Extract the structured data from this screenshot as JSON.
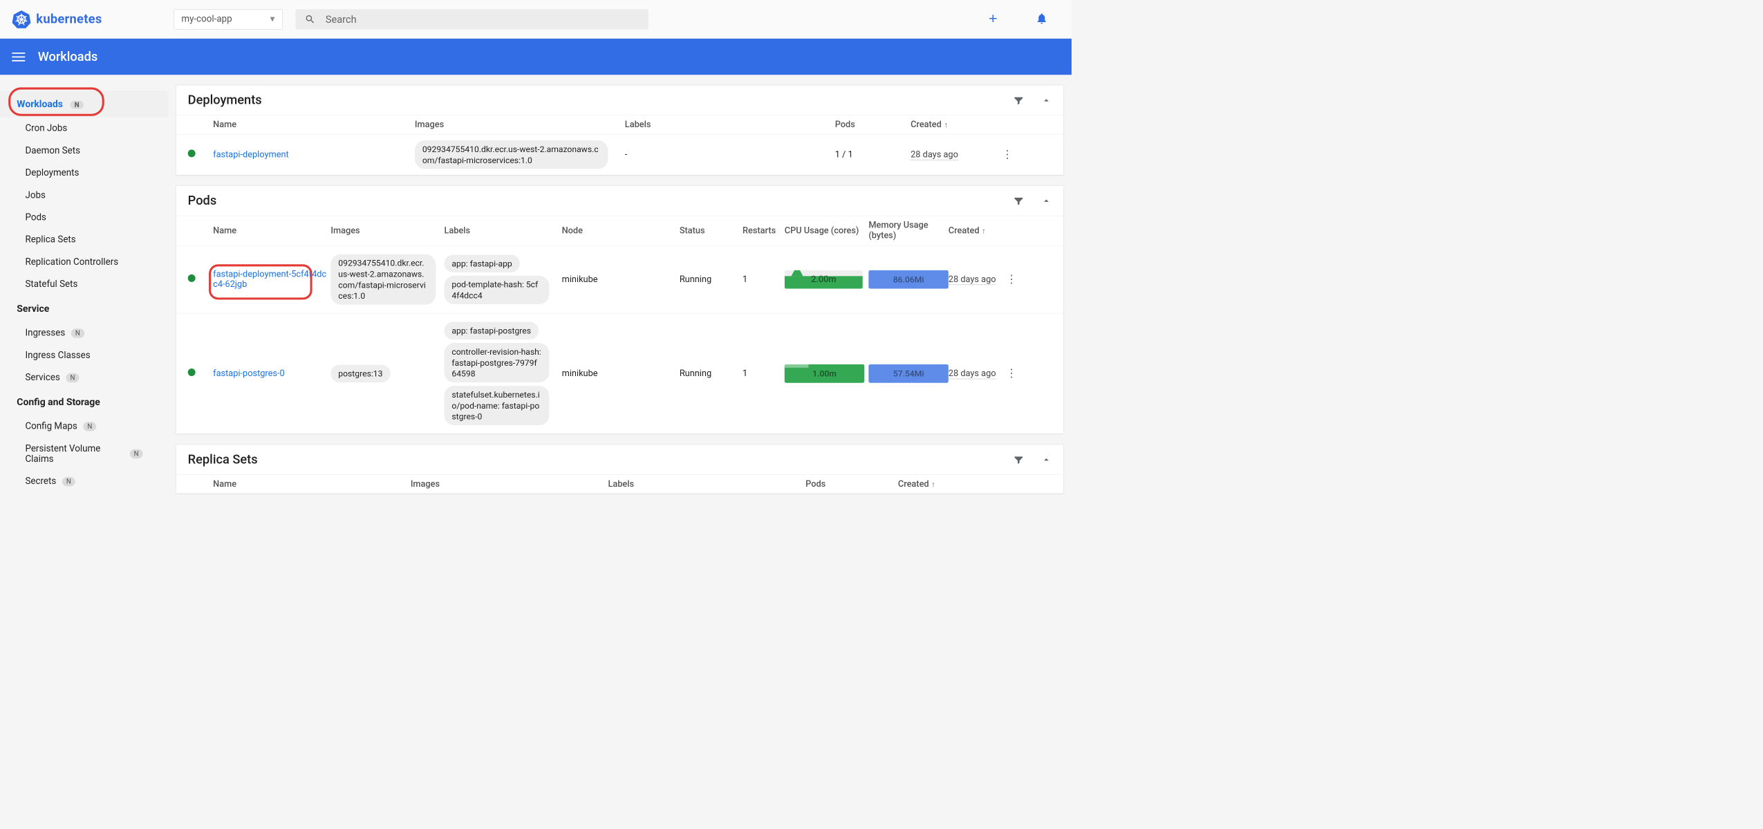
{
  "topbar": {
    "brand": "kubernetes",
    "namespace": "my-cool-app",
    "search_placeholder": "Search"
  },
  "bluebar": {
    "title": "Workloads"
  },
  "sidebar": {
    "workloads": {
      "title": "Workloads",
      "items": [
        "Cron Jobs",
        "Daemon Sets",
        "Deployments",
        "Jobs",
        "Pods",
        "Replica Sets",
        "Replication Controllers",
        "Stateful Sets"
      ]
    },
    "service": {
      "title": "Service",
      "items": [
        "Ingresses",
        "Ingress Classes",
        "Services"
      ],
      "badges": [
        true,
        false,
        true
      ]
    },
    "config": {
      "title": "Config and Storage",
      "items": [
        "Config Maps",
        "Persistent Volume Claims",
        "Secrets"
      ],
      "badges": [
        true,
        true,
        true
      ]
    }
  },
  "deployments": {
    "title": "Deployments",
    "headers": {
      "name": "Name",
      "images": "Images",
      "labels": "Labels",
      "pods": "Pods",
      "created": "Created"
    },
    "rows": [
      {
        "status": "green",
        "name": "fastapi-deployment",
        "image": "092934755410.dkr.ecr.us-west-2.amazonaws.com/fastapi-microservices:1.0",
        "labels": "-",
        "pods": "1 / 1",
        "created": "28 days ago"
      }
    ]
  },
  "pods": {
    "title": "Pods",
    "headers": {
      "name": "Name",
      "images": "Images",
      "labels": "Labels",
      "node": "Node",
      "status": "Status",
      "restarts": "Restarts",
      "cpu": "CPU Usage (cores)",
      "mem": "Memory Usage (bytes)",
      "created": "Created"
    },
    "rows": [
      {
        "status": "green",
        "name": "fastapi-deployment-5cf4f4dcc4-62jgb",
        "image": "092934755410.dkr.ecr.us-west-2.amazonaws.com/fastapi-microservices:1.0",
        "labels": [
          "app: fastapi-app",
          "pod-template-hash: 5cf4f4dcc4"
        ],
        "node": "minikube",
        "state": "Running",
        "restarts": "1",
        "cpu": "2.00m",
        "mem": "86.06Mi",
        "created": "28 days ago",
        "highlight": true
      },
      {
        "status": "green",
        "name": "fastapi-postgres-0",
        "image": "postgres:13",
        "labels": [
          "app: fastapi-postgres",
          "controller-revision-hash: fastapi-postgres-7979f64598",
          "statefulset.kubernetes.io/pod-name: fastapi-postgres-0"
        ],
        "node": "minikube",
        "state": "Running",
        "restarts": "1",
        "cpu": "1.00m",
        "mem": "57.54Mi",
        "created": "28 days ago",
        "highlight": false
      }
    ]
  },
  "replicasets": {
    "title": "Replica Sets",
    "headers": {
      "name": "Name",
      "images": "Images",
      "labels": "Labels",
      "pods": "Pods",
      "created": "Created"
    }
  },
  "badge_n": "N"
}
